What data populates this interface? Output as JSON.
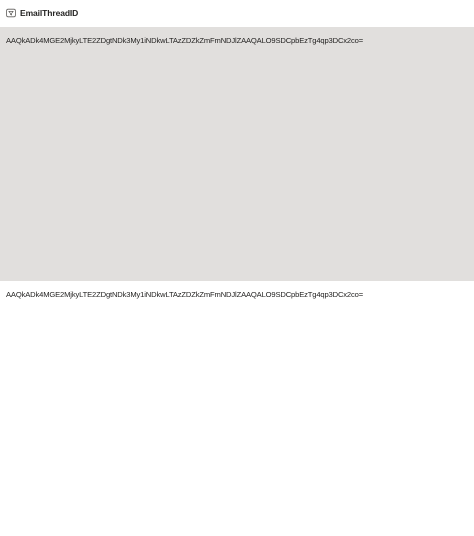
{
  "header": {
    "icon": "filter-icon",
    "title": "EmailThreadID"
  },
  "rows": [
    {
      "value": "AAQkADk4MGE2MjkyLTE2ZDgtNDk3My1iNDkwLTAzZDZkZmFmNDJlZAAQALO9SDCpbEzTg4qp3DCx2co=",
      "selected": true
    },
    {
      "value": "AAQkADk4MGE2MjkyLTE2ZDgtNDk3My1iNDkwLTAzZDZkZmFmNDJlZAAQALO9SDCpbEzTg4qp3DCx2co=",
      "selected": false
    }
  ],
  "colors": {
    "selected_background": "#e1dfdd",
    "text": "#252423"
  }
}
